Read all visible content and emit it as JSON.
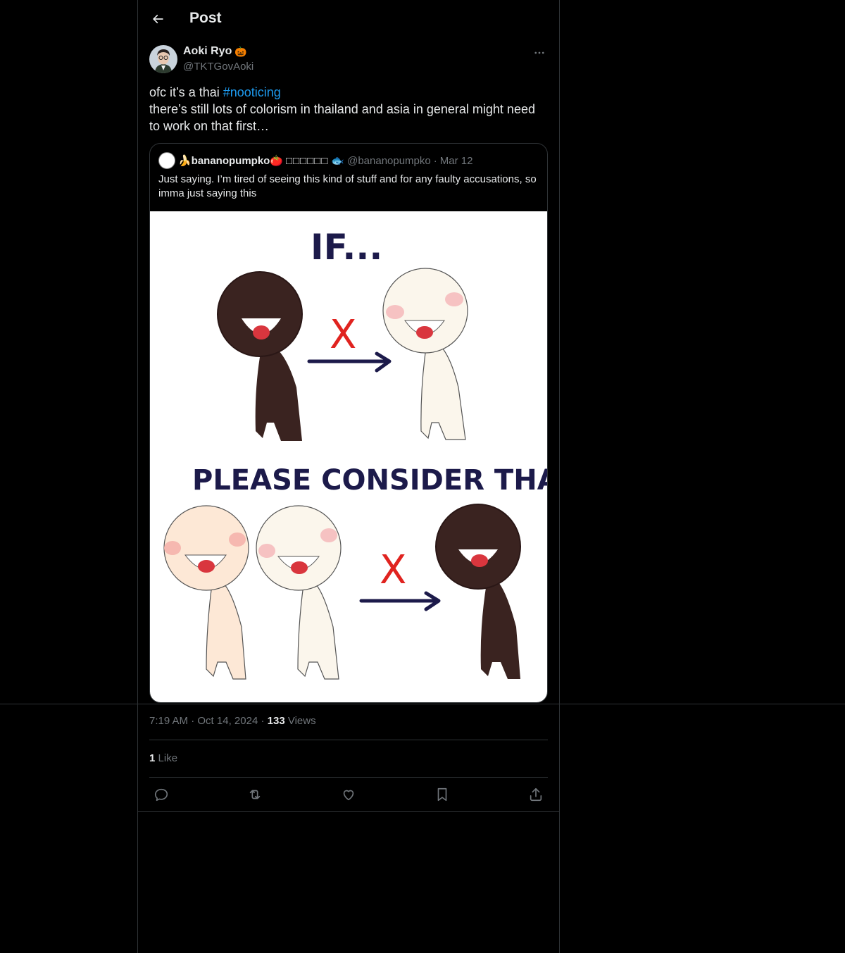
{
  "header": {
    "title": "Post"
  },
  "post": {
    "author_name": "Aoki Ryo",
    "author_emoji": "🎃",
    "author_handle": "@TKTGovAoki",
    "text_before": "ofc it’s a thai ",
    "hashtag": "#nooticing",
    "text_line2": "there’s still lots of colorism in thailand and asia in general might need to work on that first…",
    "time": "7:19 AM",
    "date": "Oct 14, 2024",
    "views_count": "133",
    "views_label": "Views",
    "like_count": "1",
    "like_label": "Like"
  },
  "quote": {
    "name": "🍌bananopumpko🍅",
    "name_extra": "□□□□□□",
    "emoji_fish": "🐟",
    "handle": "@bananopumpko",
    "separator": "·",
    "date": "Mar 12",
    "text": "Just saying. I’m tired of seeing this kind of stuff and for any faulty accusations, so imma just saying this"
  },
  "comic": {
    "heading_top": "IF...",
    "heading_bottom": "PLEASE CONSIDER THAT...",
    "cross_mark": "X",
    "colors": {
      "dark_skin": "#3a2320",
      "light_skin": "#fbf6ec",
      "peach_skin": "#fde8d6",
      "ink": "#1c1a4a",
      "cross": "#e0231f",
      "mouth": "#d9363e"
    }
  },
  "icons": [
    "back-arrow-icon",
    "more-icon",
    "reply-icon",
    "repost-icon",
    "like-icon",
    "bookmark-icon",
    "share-icon"
  ]
}
